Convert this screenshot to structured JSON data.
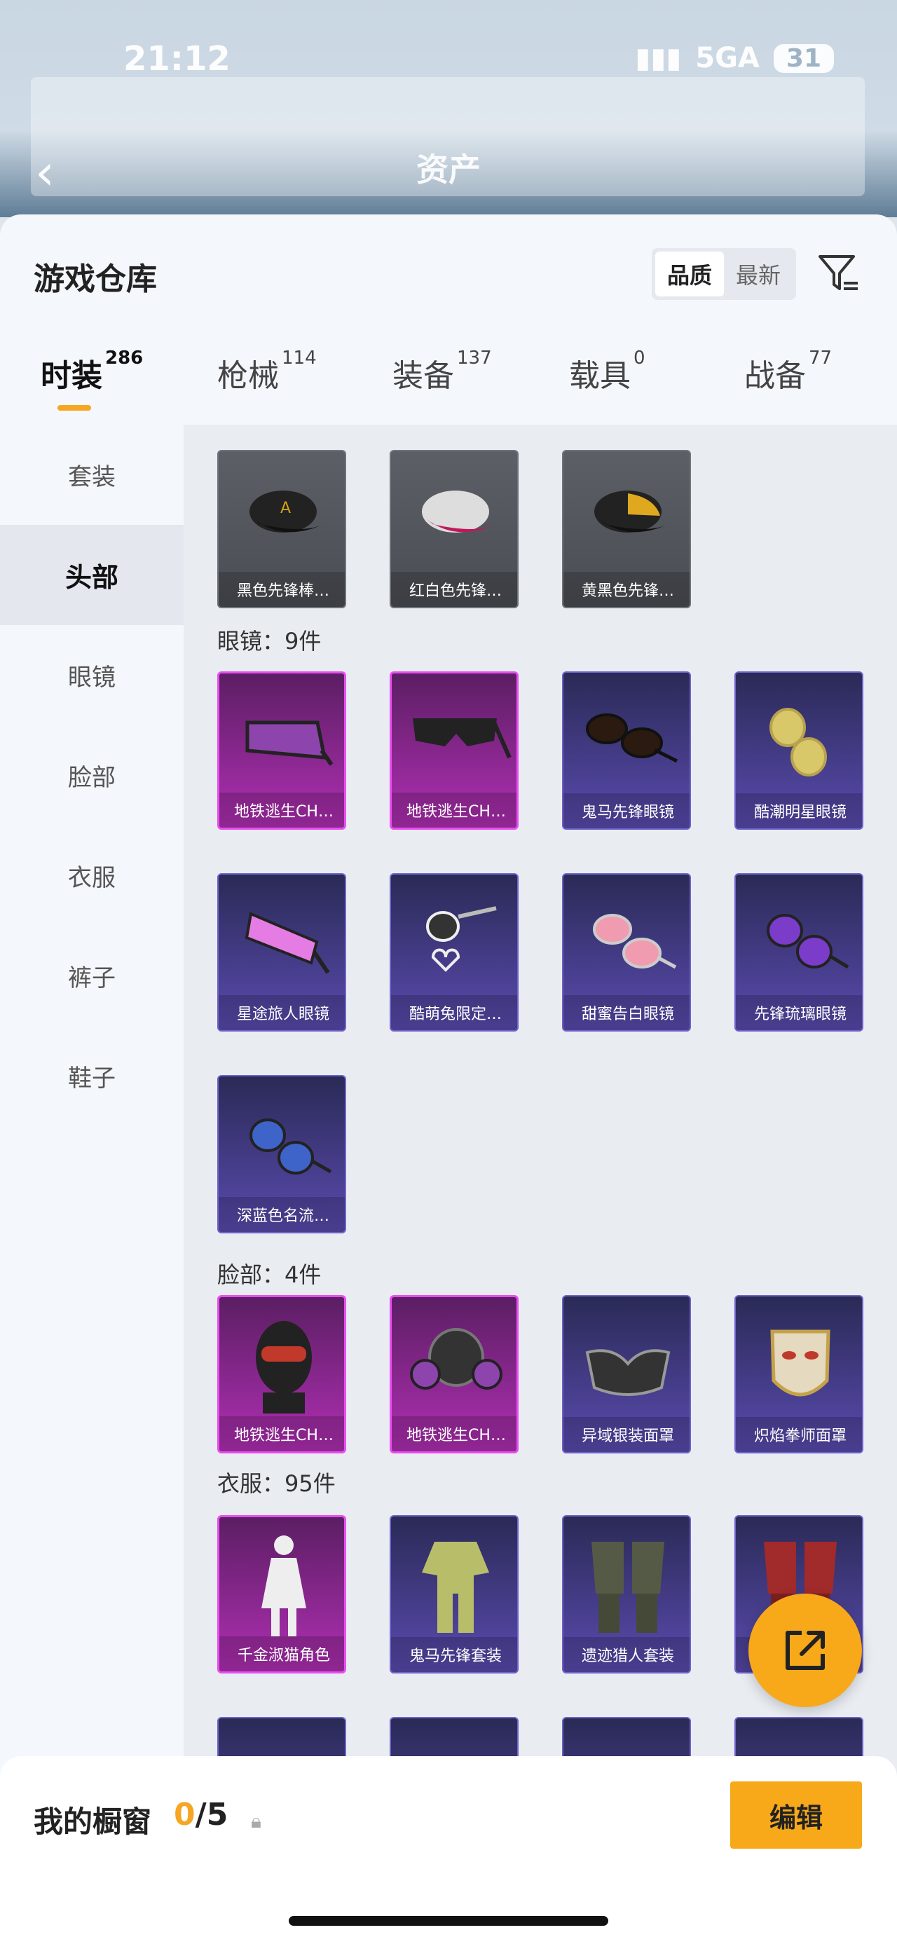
{
  "status": {
    "time": "21:12",
    "network": "5GA",
    "battery": "31"
  },
  "nav": {
    "title": "资产",
    "back_icon": "chevron-left-icon"
  },
  "warehouse": {
    "title": "游戏仓库",
    "sort": {
      "quality": "品质",
      "newest": "最新"
    },
    "filter_icon": "filter-icon"
  },
  "tabs": [
    {
      "label": "时装",
      "count": "286"
    },
    {
      "label": "枪械",
      "count": "114"
    },
    {
      "label": "装备",
      "count": "137"
    },
    {
      "label": "载具",
      "count": "0"
    },
    {
      "label": "战备",
      "count": "77"
    }
  ],
  "sidebar": [
    "套装",
    "头部",
    "眼镜",
    "脸部",
    "衣服",
    "裤子",
    "鞋子"
  ],
  "hats": [
    {
      "label": "黑色先锋棒…",
      "rarity": "grey"
    },
    {
      "label": "红白色先锋…",
      "rarity": "grey"
    },
    {
      "label": "黄黑色先锋…",
      "rarity": "grey"
    }
  ],
  "sections": {
    "glasses": "眼镜：9件",
    "face": "脸部：4件",
    "clothes": "衣服：95件"
  },
  "glasses": [
    {
      "label": "地铁逃生CH…",
      "rarity": "pink"
    },
    {
      "label": "地铁逃生CH…",
      "rarity": "pink"
    },
    {
      "label": "鬼马先锋眼镜",
      "rarity": "blue"
    },
    {
      "label": "酷潮明星眼镜",
      "rarity": "blue"
    },
    {
      "label": "星途旅人眼镜",
      "rarity": "blue"
    },
    {
      "label": "酷萌兔限定…",
      "rarity": "blue"
    },
    {
      "label": "甜蜜告白眼镜",
      "rarity": "blue"
    },
    {
      "label": "先锋琉璃眼镜",
      "rarity": "blue"
    },
    {
      "label": "深蓝色名流…",
      "rarity": "blue"
    }
  ],
  "face": [
    {
      "label": "地铁逃生CH…",
      "rarity": "pink"
    },
    {
      "label": "地铁逃生CH…",
      "rarity": "pink"
    },
    {
      "label": "异域银装面罩",
      "rarity": "blue"
    },
    {
      "label": "炽焰拳师面罩",
      "rarity": "blue"
    }
  ],
  "clothes": [
    {
      "label": "千金淑猫角色",
      "rarity": "pink"
    },
    {
      "label": "鬼马先锋套装",
      "rarity": "blue"
    },
    {
      "label": "遗迹猎人套装",
      "rarity": "blue"
    },
    {
      "label": "",
      "rarity": "blue"
    }
  ],
  "showcase": {
    "label": "我的橱窗",
    "current": "0",
    "total": "/5",
    "edit": "编辑"
  },
  "colors": {
    "accent": "#f7a91a",
    "pink_rarity": "#b12fb4",
    "blue_rarity": "#5a4bb0"
  }
}
